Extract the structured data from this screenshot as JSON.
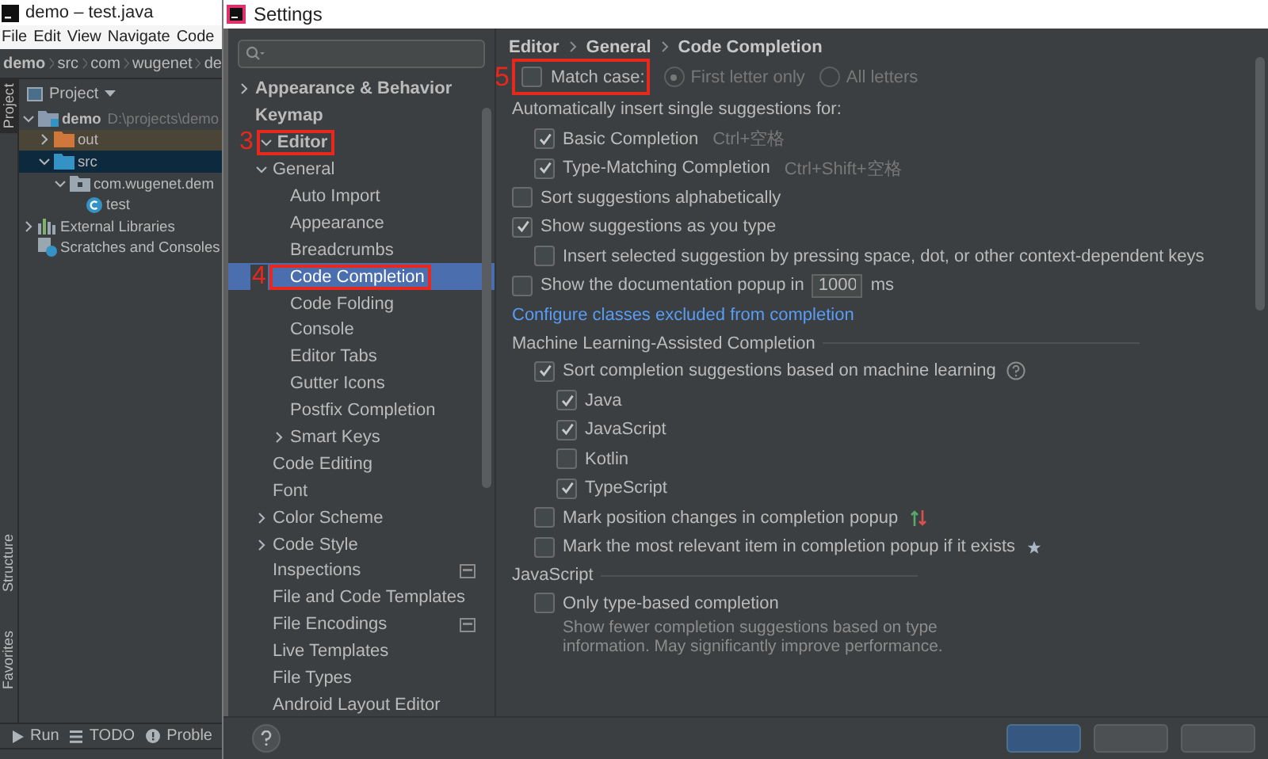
{
  "ide": {
    "title": "demo – test.java",
    "menu": [
      "File",
      "Edit",
      "View",
      "Navigate",
      "Code"
    ],
    "breadcrumb": [
      "demo",
      "src",
      "com",
      "wugenet",
      "de"
    ],
    "top_side_tabs": [
      {
        "label": "Project",
        "selected": true
      }
    ],
    "bottom_side_tabs": [
      {
        "label": "Structure",
        "selected": false
      },
      {
        "label": "Favorites",
        "selected": false
      }
    ],
    "project_panel": {
      "title": "Project",
      "tree": [
        {
          "kind": "module",
          "label": "demo",
          "hint": "D:\\projects\\demo",
          "expanded": true,
          "selected": false,
          "children": [
            {
              "kind": "excluded-folder",
              "label": "out",
              "expanded": false,
              "selected": false
            },
            {
              "kind": "source-folder",
              "label": "src",
              "expanded": true,
              "selected": true,
              "children": [
                {
                  "kind": "package",
                  "label": "com.wugenet.dem",
                  "expanded": true,
                  "selected": false,
                  "children": [
                    {
                      "kind": "class",
                      "label": "test",
                      "selected": false
                    }
                  ]
                }
              ]
            }
          ]
        },
        {
          "kind": "libraries",
          "label": "External Libraries",
          "expanded": false,
          "selected": false
        },
        {
          "kind": "scratches",
          "label": "Scratches and Consoles",
          "selected": false
        }
      ]
    },
    "tool_buttons": [
      {
        "kind": "run",
        "label": "Run"
      },
      {
        "kind": "todo",
        "label": "TODO"
      },
      {
        "kind": "problems",
        "label": "Proble"
      }
    ]
  },
  "settings": {
    "title": "Settings",
    "nav_tree": [
      {
        "label": "Appearance & Behavior",
        "expanded": false,
        "selected": false
      },
      {
        "label": "Keymap",
        "selected": false
      },
      {
        "label": "Editor",
        "expanded": true,
        "selected": false,
        "boxed": true,
        "callout": "3",
        "children": [
          {
            "label": "General",
            "expanded": true,
            "selected": false,
            "children": [
              {
                "label": "Auto Import",
                "selected": false
              },
              {
                "label": "Appearance",
                "selected": false
              },
              {
                "label": "Breadcrumbs",
                "selected": false
              },
              {
                "label": "Code Completion",
                "selected": true,
                "boxed": true,
                "callout": "4"
              },
              {
                "label": "Code Folding",
                "selected": false
              },
              {
                "label": "Console",
                "selected": false
              },
              {
                "label": "Editor Tabs",
                "selected": false
              },
              {
                "label": "Gutter Icons",
                "selected": false
              },
              {
                "label": "Postfix Completion",
                "selected": false
              },
              {
                "label": "Smart Keys",
                "expanded": false,
                "selected": false
              }
            ]
          },
          {
            "label": "Code Editing",
            "selected": false
          },
          {
            "label": "Font",
            "selected": false
          },
          {
            "label": "Color Scheme",
            "expanded": false,
            "selected": false
          },
          {
            "label": "Code Style",
            "expanded": false,
            "selected": false
          },
          {
            "label": "Inspections",
            "selected": false,
            "project_level": true
          },
          {
            "label": "File and Code Templates",
            "selected": false
          },
          {
            "label": "File Encodings",
            "selected": false,
            "project_level": true
          },
          {
            "label": "Live Templates",
            "selected": false
          },
          {
            "label": "File Types",
            "selected": false
          },
          {
            "label": "Android Layout Editor",
            "selected": false
          }
        ]
      }
    ],
    "breadcrumb": [
      "Editor",
      "General",
      "Code Completion"
    ],
    "options": [
      {
        "kind": "checkbox-radios",
        "label": "Match case:",
        "checked": false,
        "boxed": true,
        "callout": "5",
        "options": [
          {
            "label": "First letter only",
            "selected": true
          },
          {
            "label": "All letters",
            "selected": false
          }
        ]
      },
      {
        "kind": "label",
        "label": "Automatically insert single suggestions for:",
        "children": [
          {
            "kind": "checkbox",
            "label": "Basic Completion",
            "shortcut": "Ctrl+空格",
            "checked": true
          },
          {
            "kind": "checkbox",
            "label": "Type-Matching Completion",
            "shortcut": "Ctrl+Shift+空格",
            "checked": true
          }
        ]
      },
      {
        "kind": "checkbox",
        "label": "Sort suggestions alphabetically",
        "checked": false
      },
      {
        "kind": "checkbox",
        "label": "Show suggestions as you type",
        "checked": true,
        "children": [
          {
            "kind": "checkbox",
            "label": "Insert selected suggestion by pressing space, dot, or other context-dependent keys",
            "checked": false
          }
        ]
      },
      {
        "kind": "checkbox-input",
        "label": "Show the documentation popup in",
        "value": "1000",
        "unit": "ms",
        "checked": false
      },
      {
        "kind": "link",
        "label": "Configure classes excluded from completion"
      },
      {
        "kind": "section",
        "label": "Machine Learning-Assisted Completion",
        "children": [
          {
            "kind": "checkbox-help",
            "label": "Sort completion suggestions based on machine learning",
            "checked": true,
            "children": [
              {
                "kind": "checkbox",
                "label": "Java",
                "checked": true
              },
              {
                "kind": "checkbox",
                "label": "JavaScript",
                "checked": true
              },
              {
                "kind": "checkbox",
                "label": "Kotlin",
                "checked": false
              },
              {
                "kind": "checkbox",
                "label": "TypeScript",
                "checked": true
              }
            ]
          },
          {
            "kind": "checkbox-arrows",
            "label": "Mark position changes in completion popup",
            "checked": false
          },
          {
            "kind": "checkbox-star",
            "label": "Mark the most relevant item in completion popup if it exists",
            "checked": false
          }
        ]
      },
      {
        "kind": "section",
        "label": "JavaScript",
        "children": [
          {
            "kind": "checkbox",
            "label": "Only type-based completion",
            "checked": false,
            "description": "Show fewer completion suggestions based on type information. May significantly improve performance."
          }
        ]
      }
    ],
    "buttons": [
      {
        "primary": true
      },
      {
        "primary": false
      },
      {
        "primary": false
      }
    ]
  }
}
